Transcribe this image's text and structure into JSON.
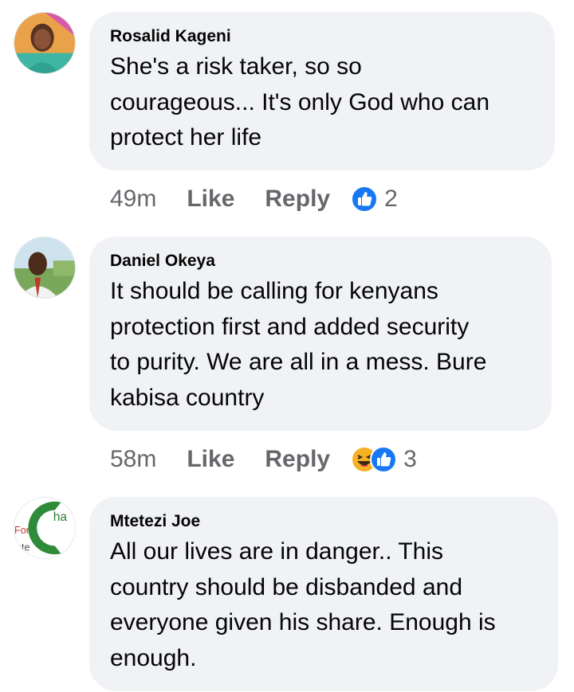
{
  "comments": [
    {
      "author": "Rosalid Kageni",
      "text": "She's a risk taker, so so\ncourageous... It's only God who can\nprotect her life",
      "time": "49m",
      "like_label": "Like",
      "reply_label": "Reply",
      "reaction_icons": [
        "like-reaction-icon"
      ],
      "reaction_count": "2"
    },
    {
      "author": "Daniel Okeya",
      "text": "It should be calling for kenyans\nprotection first and added security\nto purity. We are all in a mess. Bure\nkabisa country",
      "time": "58m",
      "like_label": "Like",
      "reply_label": "Reply",
      "reaction_icons": [
        "haha-reaction-icon",
        "like-reaction-icon"
      ],
      "reaction_count": "3"
    },
    {
      "author": "Mtetezi Joe",
      "text": "All our lives are in danger.. This\ncountry should be disbanded and\neveryone given his share. Enough is\nenough.",
      "avatar_text": [
        "ha",
        "For",
        "ate"
      ]
    }
  ],
  "colors": {
    "bubble": "#f0f2f5",
    "meta_text": "#65676b",
    "like_blue": "#1877f2",
    "haha_yellow": "#f7b125"
  }
}
